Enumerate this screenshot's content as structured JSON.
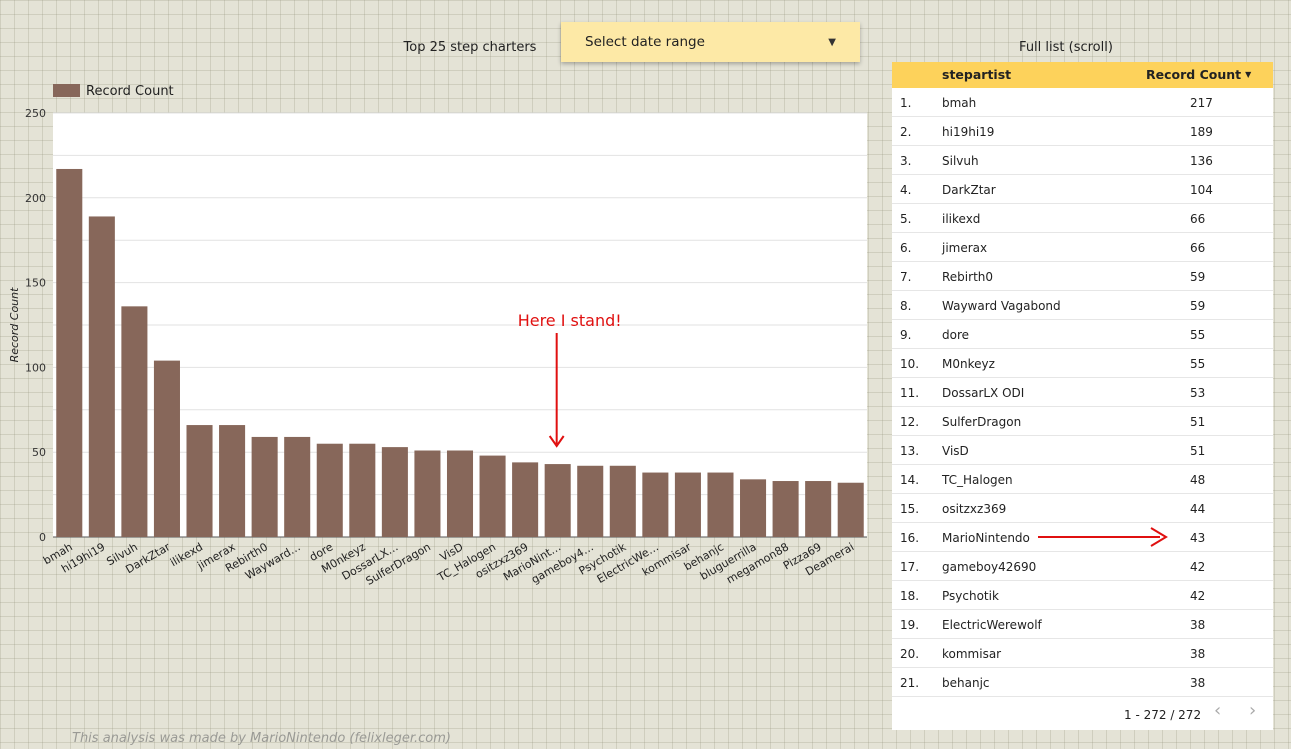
{
  "header": {
    "chart_title": "Top 25 step charters",
    "date_picker_label": "Select date range",
    "table_title": "Full list (scroll)"
  },
  "colors": {
    "bar": "#87675a",
    "table_header": "#fdd25b",
    "date_picker": "#fde9a6",
    "annotation": "#e01010"
  },
  "chart_data": {
    "type": "bar",
    "title": "",
    "legend": "Record Count",
    "legend_position": "top-left",
    "ylabel": "Record Count",
    "xlabel": "",
    "ylim": [
      0,
      250
    ],
    "yticks": [
      0,
      50,
      100,
      150,
      200,
      250
    ],
    "grid": true,
    "categories": [
      "bmah",
      "hi19hi19",
      "Silvuh",
      "DarkZtar",
      "ilikexd",
      "jimerax",
      "Rebirth0",
      "Wayward…",
      "dore",
      "M0nkeyz",
      "DossarLX…",
      "SulferDragon",
      "VisD",
      "TC_Halogen",
      "ositzxz369",
      "MarioNint…",
      "gameboy4…",
      "Psychotik",
      "ElectricWe…",
      "kommisar",
      "behanjc",
      "bluguerrilla",
      "megamon88",
      "Pizza69",
      "Deamerai"
    ],
    "values": [
      217,
      189,
      136,
      104,
      66,
      66,
      59,
      59,
      55,
      55,
      53,
      51,
      51,
      48,
      44,
      43,
      42,
      42,
      38,
      38,
      38,
      34,
      33,
      33,
      32
    ],
    "annotation": {
      "text": "Here I stand!",
      "category": "MarioNint…"
    }
  },
  "table": {
    "headers": {
      "artist": "stepartist",
      "count": "Record Count"
    },
    "rows": [
      {
        "idx": "1.",
        "name": "bmah",
        "count": "217"
      },
      {
        "idx": "2.",
        "name": "hi19hi19",
        "count": "189"
      },
      {
        "idx": "3.",
        "name": "Silvuh",
        "count": "136"
      },
      {
        "idx": "4.",
        "name": "DarkZtar",
        "count": "104"
      },
      {
        "idx": "5.",
        "name": "ilikexd",
        "count": "66"
      },
      {
        "idx": "6.",
        "name": "jimerax",
        "count": "66"
      },
      {
        "idx": "7.",
        "name": "Rebirth0",
        "count": "59"
      },
      {
        "idx": "8.",
        "name": "Wayward Vagabond",
        "count": "59"
      },
      {
        "idx": "9.",
        "name": "dore",
        "count": "55"
      },
      {
        "idx": "10.",
        "name": "M0nkeyz",
        "count": "55"
      },
      {
        "idx": "11.",
        "name": "DossarLX ODI",
        "count": "53"
      },
      {
        "idx": "12.",
        "name": "SulferDragon",
        "count": "51"
      },
      {
        "idx": "13.",
        "name": "VisD",
        "count": "51"
      },
      {
        "idx": "14.",
        "name": "TC_Halogen",
        "count": "48"
      },
      {
        "idx": "15.",
        "name": "ositzxz369",
        "count": "44"
      },
      {
        "idx": "16.",
        "name": "MarioNintendo",
        "count": "43"
      },
      {
        "idx": "17.",
        "name": "gameboy42690",
        "count": "42"
      },
      {
        "idx": "18.",
        "name": "Psychotik",
        "count": "42"
      },
      {
        "idx": "19.",
        "name": "ElectricWerewolf",
        "count": "38"
      },
      {
        "idx": "20.",
        "name": "kommisar",
        "count": "38"
      },
      {
        "idx": "21.",
        "name": "behanjc",
        "count": "38"
      }
    ],
    "highlight_row": "16.",
    "pagination": "1 - 272 / 272"
  },
  "icons": {
    "prev": "chevron-left-icon",
    "next": "chevron-right-icon",
    "sort": "sort-desc-icon",
    "dropdown": "caret-down-icon"
  },
  "footer": {
    "watermark": "This analysis was made by MarioNintendo (felixleger.com)"
  }
}
